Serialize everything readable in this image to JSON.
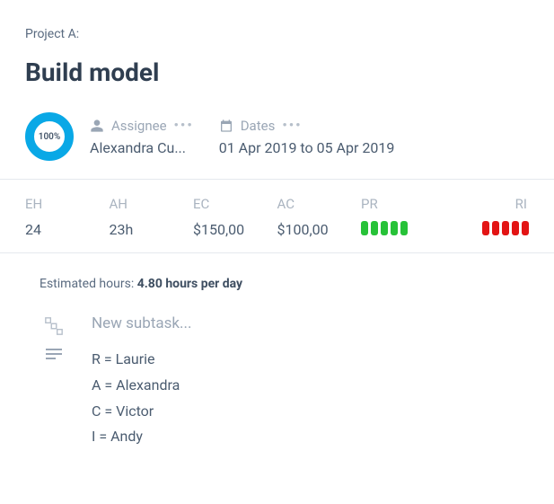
{
  "project_label": "Project A:",
  "task_title": "Build model",
  "progress": {
    "percent_text": "100%"
  },
  "assignee": {
    "label": "Assignee",
    "value": "Alexandra Cu..."
  },
  "dates": {
    "label": "Dates",
    "value": "01 Apr 2019 to 05 Apr 2019"
  },
  "metrics": {
    "eh": {
      "label": "EH",
      "value": "24"
    },
    "ah": {
      "label": "AH",
      "value": "23h"
    },
    "ec": {
      "label": "EC",
      "value": "$150,00"
    },
    "ac": {
      "label": "AC",
      "value": "$100,00"
    },
    "pr": {
      "label": "PR",
      "bars": 5,
      "color": "green"
    },
    "ri": {
      "label": "RI",
      "bars": 5,
      "color": "red"
    }
  },
  "estimated": {
    "label": "Estimated hours: ",
    "value": "4.80",
    "suffix": " hours per day"
  },
  "new_subtask_placeholder": "New subtask...",
  "raci": {
    "r": "R = Laurie",
    "a": "A = Alexandra",
    "c": "C = Victor",
    "i": "I = Andy"
  }
}
